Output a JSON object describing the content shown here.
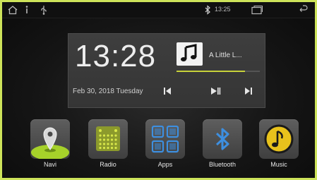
{
  "statusbar": {
    "time": "13:25",
    "icons": [
      "home-icon",
      "menu-dots-icon",
      "usb-icon",
      "bluetooth-icon",
      "recent-apps-icon",
      "back-icon"
    ]
  },
  "widget": {
    "clock": "13:28",
    "date": "Feb 30, 2018  Tuesday",
    "song_title": "A Little L...",
    "playback_progress": 0.82,
    "controls": [
      "previous-icon",
      "play-pause-icon",
      "next-icon"
    ]
  },
  "dock": {
    "apps": [
      {
        "id": "navi",
        "label": "Navi",
        "icon": "map-pin-icon"
      },
      {
        "id": "radio",
        "label": "Radio",
        "icon": "radio-grid-icon"
      },
      {
        "id": "apps",
        "label": "Apps",
        "icon": "apps-grid-icon"
      },
      {
        "id": "bluetooth",
        "label": "Bluetooth",
        "icon": "bluetooth-icon"
      },
      {
        "id": "music",
        "label": "Music",
        "icon": "music-note-icon"
      }
    ]
  },
  "colors": {
    "frame": "#cde35a",
    "accent_green": "#a6d12a",
    "accent_blue": "#3d8fe0",
    "music_yellow": "#e8c21c"
  }
}
